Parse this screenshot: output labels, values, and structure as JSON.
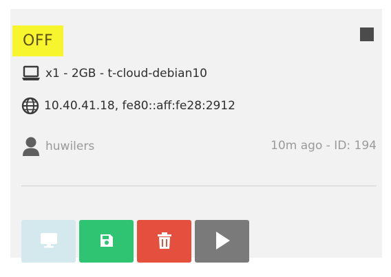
{
  "vm": {
    "status": "OFF",
    "server_line": "x1 - 2GB - t-cloud-debian10",
    "ip_line": "10.40.41.18, fe80::aff:fe28:2912",
    "owner": "huwilers",
    "meta": "10m ago - ID: 194"
  },
  "icons": {
    "stop": "stop-square-icon",
    "server": "laptop-icon",
    "network": "globe-icon",
    "user": "user-icon",
    "console": "monitor-icon",
    "save": "floppy-disk-icon",
    "delete": "trash-icon",
    "start": "play-icon"
  },
  "colors": {
    "status_highlight": "#f6f52e",
    "save": "#2ec472",
    "delete": "#e4503d",
    "start": "#7a7a7a",
    "console": "#d4e9ee"
  }
}
